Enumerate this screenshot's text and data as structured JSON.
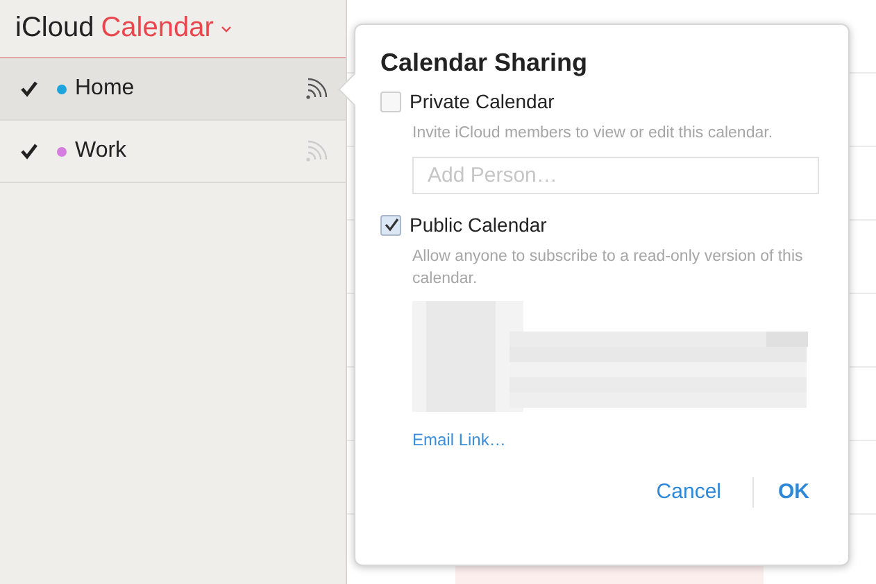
{
  "header": {
    "brand": "iCloud",
    "app": "Calendar"
  },
  "calendars": [
    {
      "name": "Home",
      "checked": true,
      "selected": true,
      "color": "#1ea5de"
    },
    {
      "name": "Work",
      "checked": true,
      "selected": false,
      "color": "#d57ee0"
    }
  ],
  "dialog": {
    "title": "Calendar Sharing",
    "options": [
      {
        "kind": "private",
        "label": "Private Calendar",
        "checked": false,
        "description": "Invite iCloud members to view or edit this calendar.",
        "placeholder": "Add Person…"
      },
      {
        "kind": "public",
        "label": "Public Calendar",
        "checked": true,
        "description": "Allow anyone to subscribe to a read-only version of this calendar.",
        "link_action": "Email Link…"
      }
    ],
    "buttons": [
      {
        "label": "Cancel",
        "primary": false
      },
      {
        "label": "OK",
        "primary": true
      }
    ]
  }
}
